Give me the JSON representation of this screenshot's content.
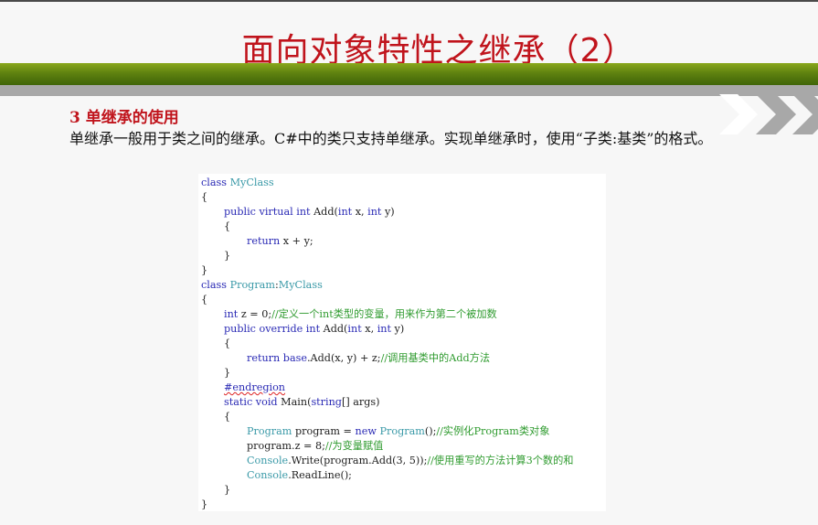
{
  "slide": {
    "title": "面向对象特性之继承（2）",
    "section_heading": "3  单继承的使用",
    "intro": "单继承一般用于类之间的继承。C#中的类只支持单继承。实现单继承时，使用“子类:基类”的格式。"
  },
  "colors": {
    "title": "#c0141c",
    "green_bar": "#5f8210",
    "gray_bar": "#a8a8a8",
    "keyword": "#2b2bb5",
    "type": "#3b9aa8",
    "comment": "#2f9b2f"
  },
  "code": {
    "l1": [
      "class ",
      "MyClass"
    ],
    "l2": "{",
    "l3": [
      "public virtual int ",
      "Add(",
      "int ",
      "x, ",
      "int ",
      "y)"
    ],
    "l4": "{",
    "l5": [
      "return ",
      "x + y;"
    ],
    "l6": "}",
    "l7": "}",
    "l8": [
      "class ",
      "Program",
      ":",
      "MyClass"
    ],
    "l9": "{",
    "l10": [
      "int ",
      "z = 0;",
      "//定义一个int类型的变量，用来作为第二个被加数"
    ],
    "l11": [
      "public override int ",
      "Add(",
      "int ",
      "x, ",
      "int ",
      "y)"
    ],
    "l12": "{",
    "l13": [
      "return base",
      ".Add(x, y) + z;",
      "//调用基类中的Add方法"
    ],
    "l14": "}",
    "l15": "#endregion",
    "l16": [
      "static void ",
      "Main(",
      "string",
      "[] args)"
    ],
    "l17": "{",
    "l18": [
      "Program ",
      "program = ",
      "new ",
      "Program",
      "();",
      "//实例化Program类对象"
    ],
    "l19": [
      "program.z = 8;",
      "//为变量赋值"
    ],
    "l20": [
      "Console",
      ".Write(program.Add(3, 5));",
      "//使用重写的方法计算3个数的和"
    ],
    "l21": [
      "Console",
      ".ReadLine();"
    ],
    "l22": "}",
    "l23": "}"
  }
}
